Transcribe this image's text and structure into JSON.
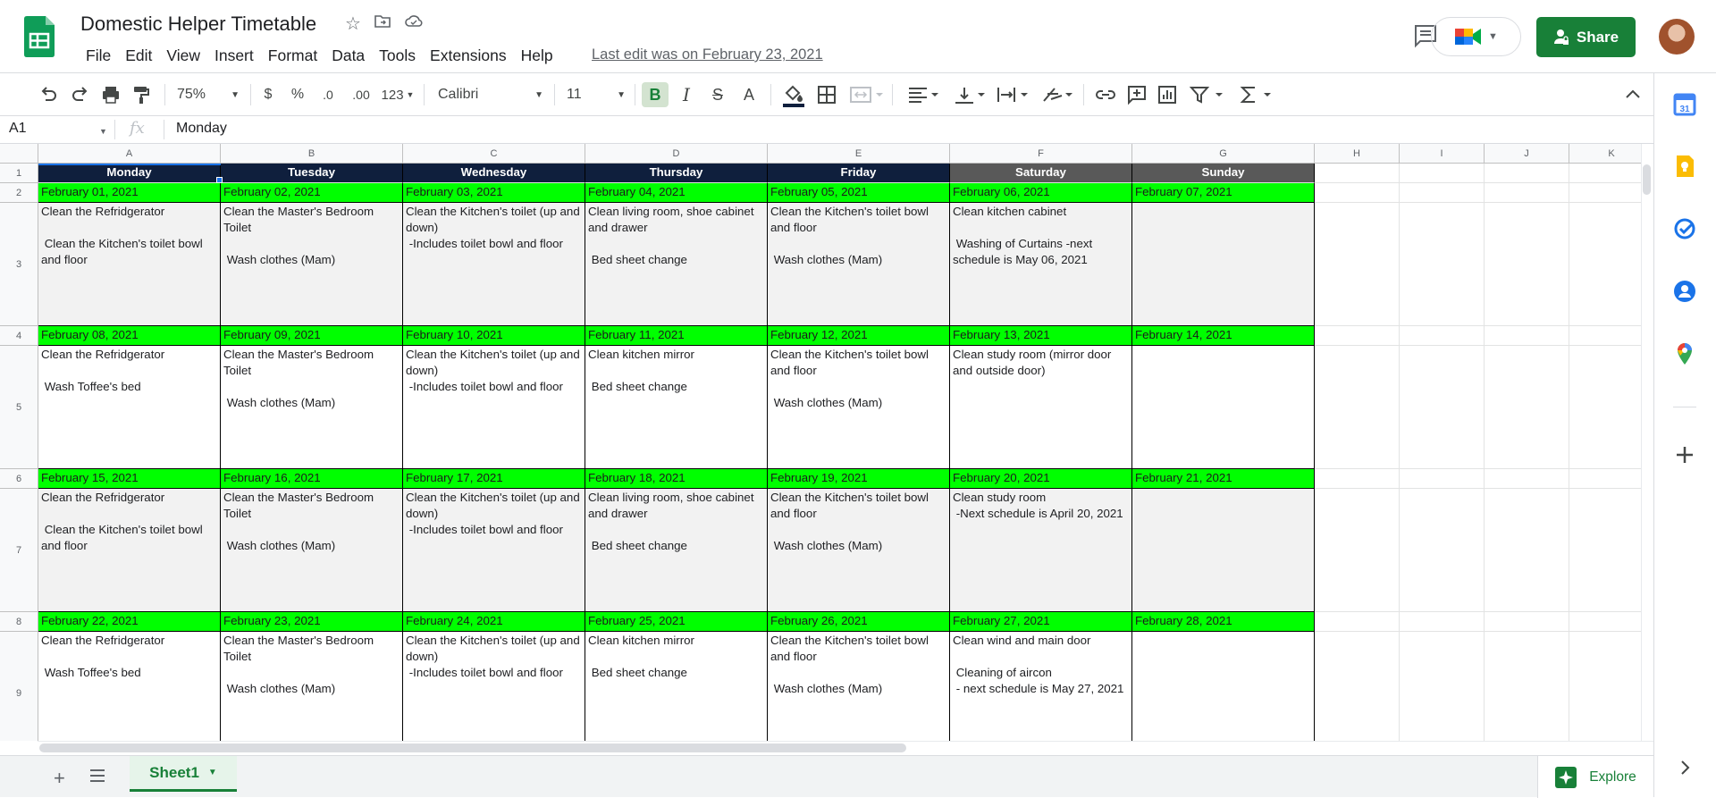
{
  "doc": {
    "title": "Domestic Helper Timetable",
    "last_edit": "Last edit was on February 23, 2021",
    "share_label": "Share"
  },
  "menu": [
    "File",
    "Edit",
    "View",
    "Insert",
    "Format",
    "Data",
    "Tools",
    "Extensions",
    "Help"
  ],
  "toolbar": {
    "zoom": "75%",
    "currency": "$",
    "percent": "%",
    "dec_decrease": ".0",
    "dec_increase": ".00",
    "number_format": "123",
    "font": "Calibri",
    "font_size": "11",
    "bold": "B",
    "italic": "I",
    "strike": "S",
    "text_color": "A"
  },
  "formula_bar": {
    "cell_ref": "A1",
    "fx": "fx",
    "value": "Monday"
  },
  "columns": [
    "A",
    "B",
    "C",
    "D",
    "E",
    "F",
    "G",
    "H",
    "I",
    "J",
    "K"
  ],
  "rows": [
    "1",
    "2",
    "3",
    "4",
    "5",
    "6",
    "7",
    "8",
    "9"
  ],
  "days": [
    "Monday",
    "Tuesday",
    "Wednesday",
    "Thursday",
    "Friday",
    "Saturday",
    "Sunday"
  ],
  "weeks": [
    {
      "dates": [
        "February 01, 2021",
        "February 02, 2021",
        "February 03, 2021",
        "February 04, 2021",
        "February 05, 2021",
        "February 06, 2021",
        "February 07, 2021"
      ],
      "tasks": [
        "Clean the Refridgerator\n\n Clean the Kitchen's toilet bowl and floor",
        "Clean the Master's Bedroom Toilet\n\n Wash clothes (Mam)",
        "Clean the Kitchen's toilet (up and down)\n -Includes toilet bowl and floor",
        "Clean living room, shoe cabinet and drawer\n\n Bed sheet change",
        "Clean the Kitchen's toilet bowl and floor\n\n Wash clothes (Mam)",
        "Clean kitchen cabinet\n\n Washing of Curtains -next schedule is May 06, 2021",
        ""
      ]
    },
    {
      "dates": [
        "February 08, 2021",
        "February 09, 2021",
        "February 10, 2021",
        "February 11, 2021",
        "February 12, 2021",
        "February 13, 2021",
        "February 14, 2021"
      ],
      "tasks": [
        "Clean the Refridgerator\n\n Wash Toffee's bed",
        "Clean the Master's Bedroom Toilet\n\n Wash clothes (Mam)",
        "Clean the Kitchen's toilet (up and down)\n -Includes toilet bowl and floor",
        "Clean kitchen mirror\n\n Bed sheet change",
        "Clean the Kitchen's toilet bowl and floor\n\n Wash clothes (Mam)",
        "Clean study room (mirror door and outside door)",
        ""
      ]
    },
    {
      "dates": [
        "February 15, 2021",
        "February 16, 2021",
        "February 17, 2021",
        "February 18, 2021",
        "February 19, 2021",
        "February 20, 2021",
        "February 21, 2021"
      ],
      "tasks": [
        "Clean the Refridgerator\n\n Clean the Kitchen's toilet bowl and floor",
        "Clean the Master's Bedroom Toilet\n\n Wash clothes (Mam)",
        "Clean the Kitchen's toilet (up and down)\n -Includes toilet bowl and floor",
        "Clean living room, shoe cabinet and drawer\n\n Bed sheet change",
        "Clean the Kitchen's toilet bowl and floor\n\n Wash clothes (Mam)",
        "Clean study room\n -Next schedule is April 20, 2021",
        ""
      ]
    },
    {
      "dates": [
        "February 22, 2021",
        "February 23, 2021",
        "February 24, 2021",
        "February 25, 2021",
        "February 26, 2021",
        "February 27, 2021",
        "February 28, 2021"
      ],
      "tasks": [
        "Clean the Refridgerator\n\n Wash Toffee's bed",
        "Clean the Master's Bedroom Toilet\n\n Wash clothes (Mam)",
        "Clean the Kitchen's toilet (up and down)\n -Includes toilet bowl and floor",
        "Clean kitchen mirror\n\n Bed sheet change",
        "Clean the Kitchen's toilet bowl and floor\n\n Wash clothes (Mam)",
        "Clean wind and main door\n\n Cleaning of aircon\n - next schedule is May 27, 2021",
        ""
      ]
    }
  ],
  "sheet_tab": "Sheet1",
  "explore_label": "Explore",
  "colors": {
    "header_dark": "#0f1f3d",
    "header_weekend": "#595959",
    "date_green": "#00ff00",
    "shade": "#f2f2f2",
    "brand_green": "#188038"
  }
}
